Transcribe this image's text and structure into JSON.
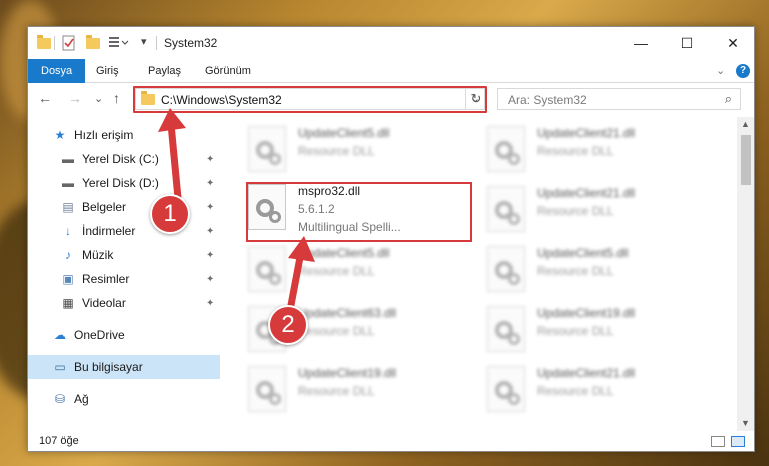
{
  "window": {
    "title": "System32",
    "minimize_glyph": "—",
    "maximize_glyph": "☐",
    "close_glyph": "✕"
  },
  "ribbon": {
    "tabs": [
      {
        "label": "Dosya",
        "active": true
      },
      {
        "label": "Giriş",
        "active": false
      },
      {
        "label": "Paylaş",
        "active": false
      },
      {
        "label": "Görünüm",
        "active": false
      }
    ],
    "help": "?"
  },
  "nav": {
    "back": "←",
    "forward": "→",
    "recent": "⌄",
    "up": "↑",
    "address": "C:\\Windows\\System32",
    "address_chevron": "⌄",
    "refresh": "↻",
    "search_placeholder": "Ara: System32",
    "search_icon": "⌕"
  },
  "sidebar": {
    "items": [
      {
        "label": "Hızlı erişim",
        "icon": "star-icon",
        "glyph": "★",
        "pinned": false
      },
      {
        "label": "Yerel Disk (C:)",
        "icon": "drive-icon",
        "glyph": "▬",
        "pinned": true
      },
      {
        "label": "Yerel Disk (D:)",
        "icon": "drive-icon",
        "glyph": "▬",
        "pinned": true
      },
      {
        "label": "Belgeler",
        "icon": "documents-icon",
        "glyph": "▤",
        "pinned": true
      },
      {
        "label": "İndirmeler",
        "icon": "download-icon",
        "glyph": "↓",
        "pinned": true
      },
      {
        "label": "Müzik",
        "icon": "music-icon",
        "glyph": "♪",
        "pinned": true
      },
      {
        "label": "Resimler",
        "icon": "pictures-icon",
        "glyph": "▣",
        "pinned": true
      },
      {
        "label": "Videolar",
        "icon": "video-icon",
        "glyph": "▦",
        "pinned": true
      },
      {
        "label": "OneDrive",
        "icon": "cloud-icon",
        "glyph": "☁",
        "pinned": false
      },
      {
        "label": "Bu bilgisayar",
        "icon": "computer-icon",
        "glyph": "▭",
        "pinned": false,
        "selected": true
      },
      {
        "label": "Ağ",
        "icon": "network-icon",
        "glyph": "⛁",
        "pinned": false
      }
    ],
    "pin_glyph": "📌"
  },
  "files": {
    "left": [
      {
        "name": "UpdateClient5.dll",
        "desc": "Resource DLL"
      },
      {
        "name": "mspro32.dll",
        "version": "5.6.1.2",
        "desc": "Multilingual Spelli..."
      },
      {
        "name": "UpdateClient5.dll",
        "desc": "Resource DLL"
      },
      {
        "name": "UpdateClient63.dll",
        "desc": "Resource DLL"
      },
      {
        "name": "UpdateClient19.dll",
        "desc": "Resource DLL"
      }
    ],
    "right": [
      {
        "name": "UpdateClient21.dll",
        "desc": "Resource DLL"
      },
      {
        "name": "UpdateClient21.dll",
        "desc": "Resource DLL"
      },
      {
        "name": "UpdateClient5.dll",
        "desc": "Resource DLL"
      },
      {
        "name": "UpdateClient19.dll",
        "desc": "Resource DLL"
      },
      {
        "name": "UpdateClient21.dll",
        "desc": "Resource DLL"
      }
    ]
  },
  "status": {
    "count": "107 öğe"
  },
  "annotations": {
    "badge1": "1",
    "badge2": "2",
    "color": "#d63a3a"
  }
}
